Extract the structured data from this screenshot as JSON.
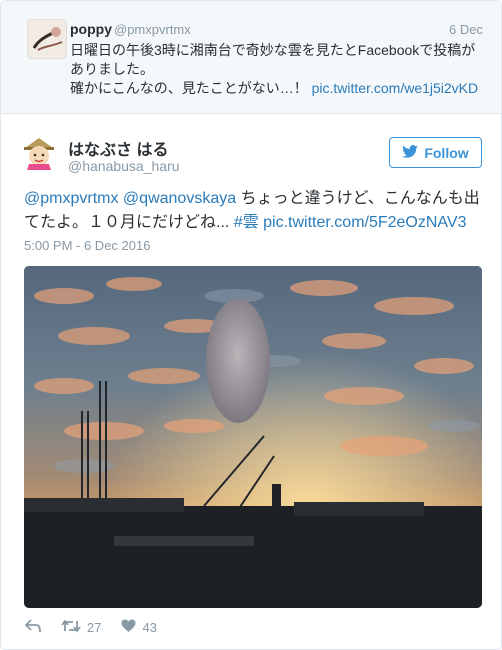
{
  "quoted": {
    "name": "poppy",
    "handle": "@pmxpvrtmx",
    "date": "6 Dec",
    "text_line1": "日曜日の午後3時に湘南台で奇妙な雲を見たとFacebookで投稿が",
    "text_line2": "ありました。",
    "text_line3": "確かにこんなの、見たことがない…！",
    "link": "pic.twitter.com/we1j5i2vKD"
  },
  "tweet": {
    "name": "はなぶさ はる",
    "handle": "@hanabusa_haru",
    "follow_label": "Follow",
    "mention1": "@pmxpvrtmx",
    "mention2": "@qwanovskaya",
    "text1": "ちょっと違うけど、こんなんも出",
    "text2": "てたよ。１０月にだけどね...",
    "hashtag": "#雲",
    "link": "pic.twitter.com/5F2eOzNAV3",
    "timestamp": "5:00 PM - 6 Dec 2016"
  },
  "actions": {
    "retweets": "27",
    "likes": "43"
  },
  "colors": {
    "link": "#2b7bb9",
    "follow": "#3b94d9",
    "muted": "#8899a6"
  }
}
